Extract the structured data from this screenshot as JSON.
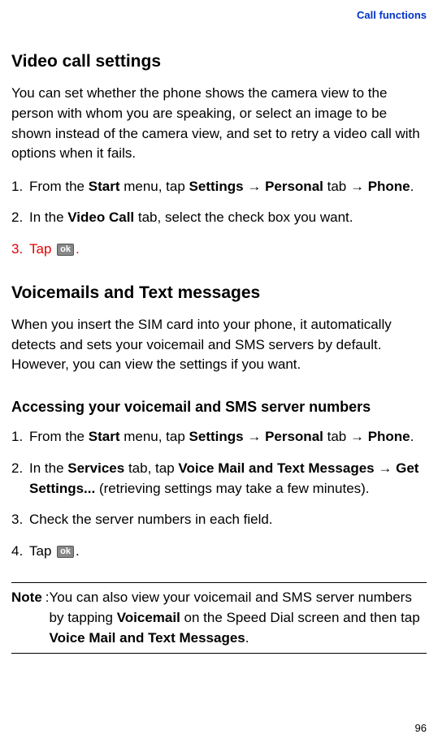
{
  "header": {
    "link": "Call functions"
  },
  "section1": {
    "title": "Video call settings",
    "intro": "You can set whether the phone shows the camera view to the person with whom you are speaking, or select an image to be shown instead of the camera view, and set to retry a video call with options when it fails.",
    "step1_prefix": "From the ",
    "step1_b1": "Start",
    "step1_mid1": " menu, tap ",
    "step1_b2": "Settings",
    "step1_arrow1": " → ",
    "step1_b3": "Personal",
    "step1_mid2": " tab → ",
    "step1_b4": "Phone",
    "step1_suffix": ".",
    "step2_prefix": "In the ",
    "step2_b1": "Video Call",
    "step2_suffix": " tab, select the check box you want.",
    "step3_prefix": "Tap ",
    "step3_btn": "ok",
    "step3_suffix": "."
  },
  "section2": {
    "title": "Voicemails and Text messages",
    "intro": "When you insert the SIM card into your phone, it automatically detects and sets your voicemail and SMS servers by default. However, you can view the settings if you want."
  },
  "section3": {
    "subtitle": "Accessing your voicemail and SMS server numbers",
    "step1_prefix": "From the ",
    "step1_b1": "Start",
    "step1_mid1": " menu, tap ",
    "step1_b2": "Settings",
    "step1_arrow1": " → ",
    "step1_b3": "Personal",
    "step1_mid2": " tab → ",
    "step1_b4": "Phone",
    "step1_suffix": ".",
    "step2_prefix": "In the ",
    "step2_b1": "Services",
    "step2_mid1": " tab, tap ",
    "step2_b2": "Voice Mail and Text Messages",
    "step2_arrow": " → ",
    "step2_b3": "Get Settings...",
    "step2_suffix": " (retrieving settings may take a few minutes).",
    "step3": "Check the server numbers in each field.",
    "step4_prefix": "Tap ",
    "step4_btn": "ok",
    "step4_suffix": "."
  },
  "note": {
    "label": "Note",
    "colon": ": ",
    "prefix": "You can also view your voicemail and SMS server numbers by tapping ",
    "b1": "Voicemail",
    "mid": " on the Speed Dial screen and then tap ",
    "b2": "Voice Mail and Text Messages",
    "suffix": "."
  },
  "page_number": "96"
}
